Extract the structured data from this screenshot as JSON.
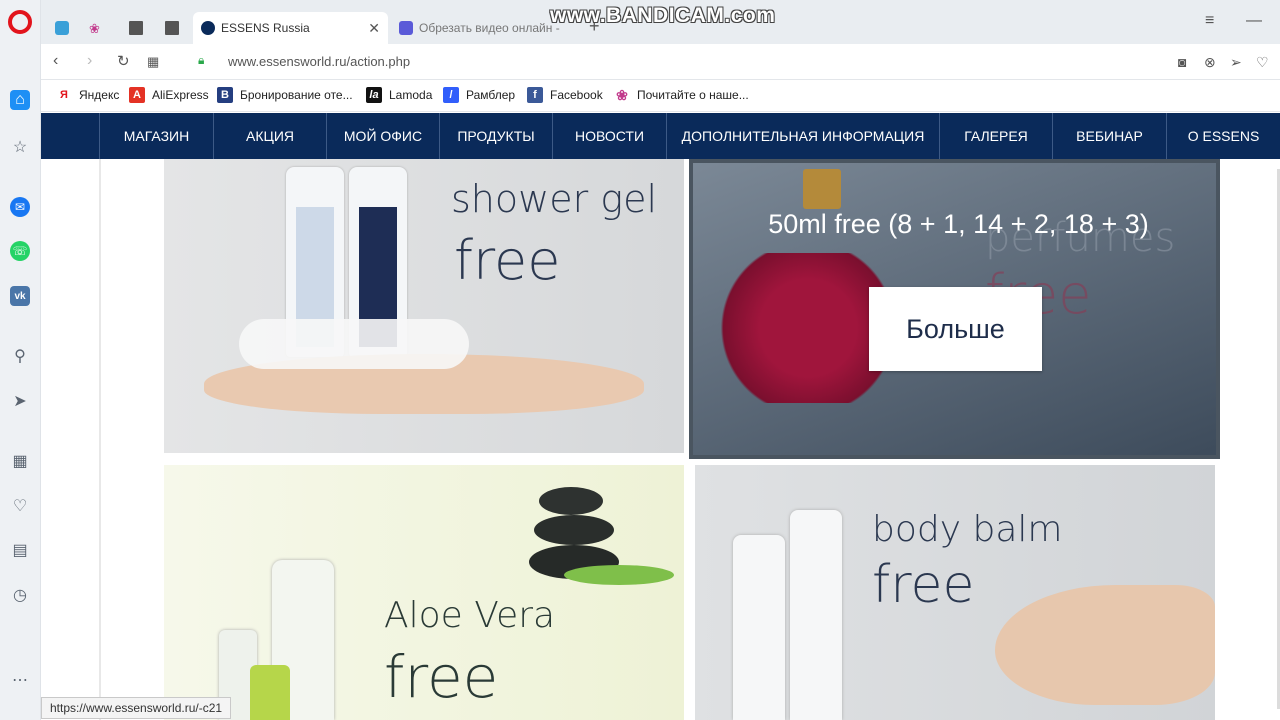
{
  "watermark": "www.BANDICAM.com",
  "tabs": [
    {
      "label": "",
      "icon": "pinned-tab-icon"
    },
    {
      "label": "",
      "icon": "flower-tab-icon"
    },
    {
      "label": "",
      "icon": "document-tab-icon"
    },
    {
      "label": "",
      "icon": "document-tab-icon"
    },
    {
      "label": "ESSENS Russia",
      "icon": "essens-favicon"
    },
    {
      "label": "Обрезать видео онлайн -",
      "icon": "video-favicon"
    }
  ],
  "address": {
    "url": "www.essensworld.ru/action.php"
  },
  "bookmarks": [
    {
      "label": "Яндекс",
      "icon": "Я"
    },
    {
      "label": "AliExpress",
      "icon": "A"
    },
    {
      "label": "Бронирование оте...",
      "icon": "B"
    },
    {
      "label": "Lamoda",
      "icon": "la"
    },
    {
      "label": "Рамблер",
      "icon": "/"
    },
    {
      "label": "Facebook",
      "icon": "f"
    },
    {
      "label": "Почитайте о наше...",
      "icon": "❀"
    }
  ],
  "nav": [
    "МАГАЗИН",
    "АКЦИЯ",
    "МОЙ ОФИС",
    "ПРОДУКТЫ",
    "НОВОСТИ",
    "ДОПОЛНИТЕЛЬНАЯ ИНФОРМАЦИЯ",
    "ГАЛЕРЕЯ",
    "ВЕБИНАР",
    "О ESSENS"
  ],
  "tiles": {
    "shower": {
      "line1": "shower gel",
      "line2": "free"
    },
    "perfume": {
      "overlay": "50ml free (8 + 1, 14 + 2, 18 + 3)",
      "button": "Больше",
      "bg1": "perfumes",
      "bg2": "free"
    },
    "aloe": {
      "line1": "Aloe Vera",
      "line2": "free"
    },
    "balm": {
      "line1": "body balm",
      "line2": "free"
    }
  },
  "status_url": "https://www.essensworld.ru/-c21",
  "colors": {
    "nav_bg": "#0a2a5a",
    "accent": "#1e8ff5"
  }
}
